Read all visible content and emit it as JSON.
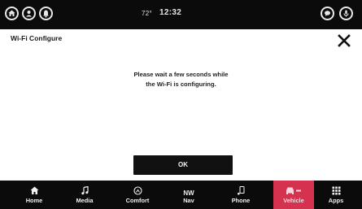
{
  "status_bar": {
    "temperature": "72°",
    "time": "12:32",
    "left_icons": [
      "home-icon",
      "user-profile-icon",
      "notification-icon"
    ],
    "right_icons": [
      "chat-bubble-icon",
      "microphone-icon"
    ]
  },
  "screen": {
    "title": "Wi-Fi Configure",
    "message_line1": "Please wait a few seconds while",
    "message_line2": "the Wi-Fi is configuring.",
    "ok_label": "OK"
  },
  "nav": {
    "items": [
      {
        "label": "Home",
        "icon": "home-icon"
      },
      {
        "label": "Media",
        "icon": "music-note-icon"
      },
      {
        "label": "Comfort",
        "icon": "comfort-dial-icon"
      },
      {
        "label": "Nav",
        "icon": "compass-icon",
        "icon_text": "NW"
      },
      {
        "label": "Phone",
        "icon": "phone-icon"
      },
      {
        "label": "Vehicle",
        "icon": "car-icon",
        "active": true
      },
      {
        "label": "Apps",
        "icon": "apps-grid-icon"
      }
    ]
  },
  "colors": {
    "bar_background": "#0b0b0c",
    "accent_active": "#d4324f",
    "button_background": "#111111"
  }
}
